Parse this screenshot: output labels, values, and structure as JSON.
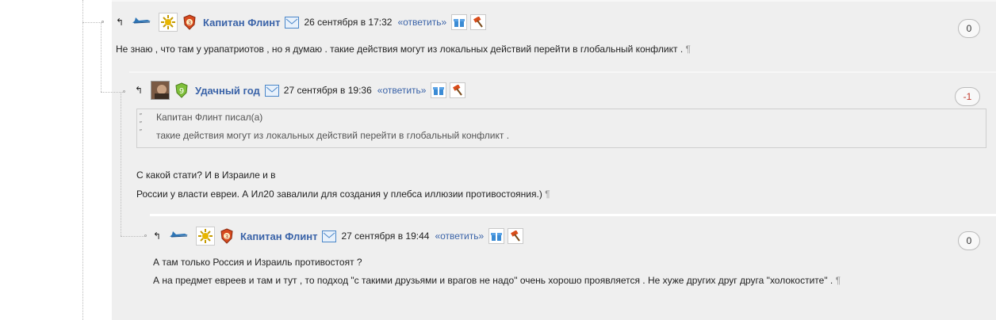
{
  "comments": [
    {
      "author": "Капитан Флинт",
      "date": "26 сентября в 17:32",
      "reply": "«ответить»",
      "rating": "0",
      "text": "Не знаю , что там у урапатриотов , но я думаю . такие действия могут из локальных действий перейти в глобальный конфликт . ",
      "pilcrow": "¶"
    },
    {
      "author": "Удачный год",
      "date": "27 сентября в 19:36",
      "reply": "«ответить»",
      "rating": "-1",
      "quote": {
        "author": "Капитан Флинт писал(а)",
        "text": "такие действия могут из локальных действий перейти в глобальный конфликт ."
      },
      "lines": [
        "С какой стати? И в Израиле и в",
        "России у власти евреи. А Ил20 завалили для создания у плебса иллюзии противостояния.) "
      ],
      "pilcrow": "¶"
    },
    {
      "author": "Капитан Флинт",
      "date": "27 сентября в 19:44",
      "reply": "«ответить»",
      "rating": "0",
      "lines": [
        "А там только Россия и Израиль противостоят ?",
        "А на предмет евреев и там и тут , то подход \"с такими друзьями и врагов не надо\" очень хорошо проявляется . Не хуже других друг друга \"холокостите\" . "
      ],
      "pilcrow": "¶"
    }
  ],
  "colors": {
    "author": "#3a63a8",
    "negative_rating": "#c0392b",
    "background": "#efefef"
  },
  "icons": [
    "back-arrow-icon",
    "plane-icon",
    "sun-badge-icon",
    "rank-shield-icon",
    "mail-icon",
    "gift-icon",
    "hammer-icon",
    "user-photo-avatar",
    "green-shield-icon"
  ]
}
